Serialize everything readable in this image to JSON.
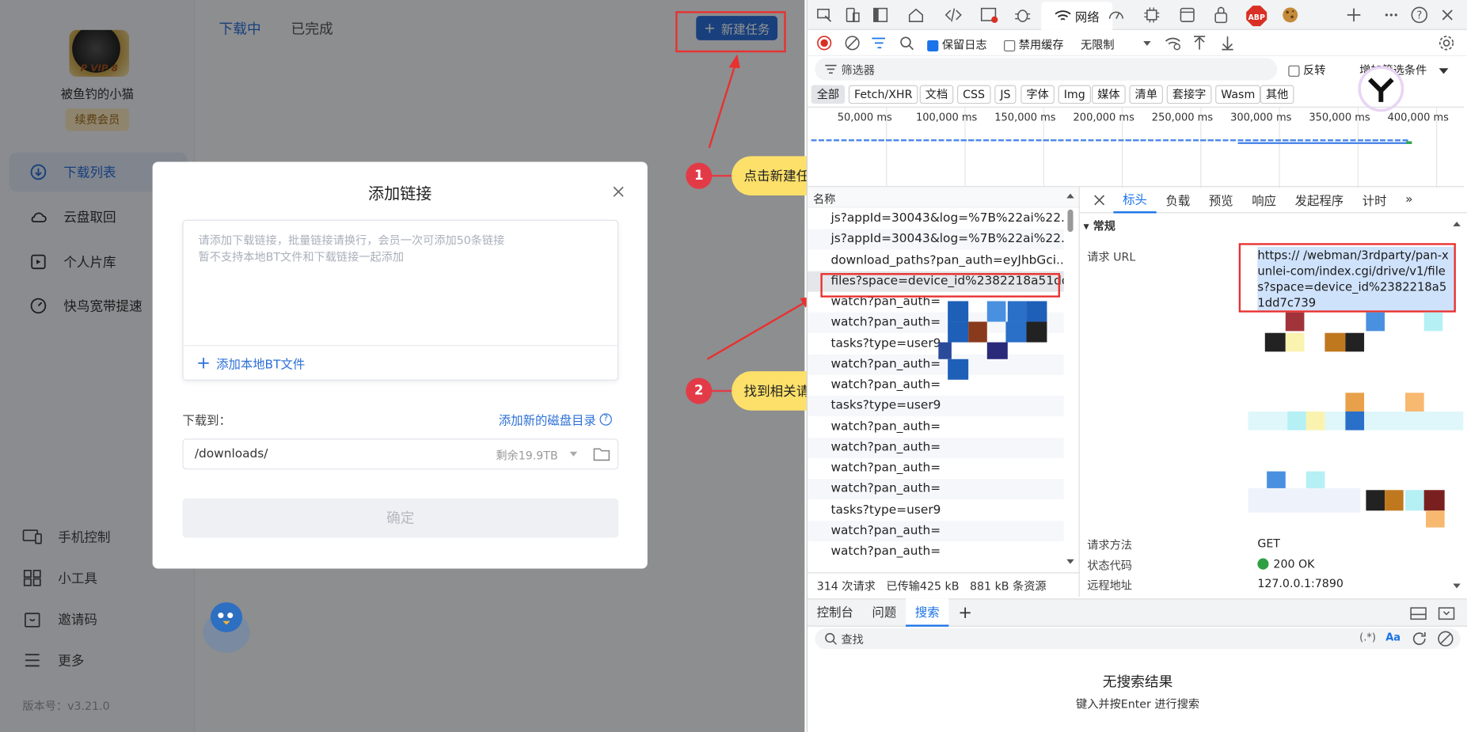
{
  "app": {
    "user": {
      "name": "被鱼钓的小猫",
      "avatar_text": "P VIP 8",
      "vip_label": "续费会员"
    },
    "nav": [
      {
        "label": "下载列表"
      },
      {
        "label": "云盘取回"
      },
      {
        "label": "个人片库"
      },
      {
        "label": "快鸟宽带提速"
      }
    ],
    "bottom_nav": [
      {
        "label": "手机控制"
      },
      {
        "label": "小工具"
      },
      {
        "label": "邀请码"
      },
      {
        "label": "更多"
      }
    ],
    "version": "版本号：v3.21.0",
    "tabs": {
      "downloading": "下载中",
      "completed": "已完成"
    },
    "new_task_label": "新建任务"
  },
  "dialog": {
    "title": "添加链接",
    "placeholder_line1": "请添加下载链接，批量链接请换行，会员一次可添加50条链接",
    "placeholder_line2": "暂不支持本地BT文件和下载链接一起添加",
    "add_bt_label": "添加本地BT文件",
    "save_to_label": "下载到：",
    "add_dir_label": "添加新的磁盘目录",
    "path": "/downloads/",
    "free_space": "剩余19.9TB",
    "confirm_label": "确定"
  },
  "annotations": {
    "step1": {
      "num": "1",
      "text": "点击新建任务"
    },
    "step2": {
      "num": "2",
      "text": "找到相关请求"
    },
    "accent": "#e8312f",
    "callout_color": "#fde069"
  },
  "devtools": {
    "network_tab": "网络",
    "preserve_log": "保留日志",
    "disable_cache": "禁用缓存",
    "throttle": "无限制",
    "filter_placeholder": "筛选器",
    "invert_label": "反转",
    "more_filters": "增加筛选条件",
    "type_filters": [
      "全部",
      "Fetch/XHR",
      "文档",
      "CSS",
      "JS",
      "字体",
      "Img",
      "媒体",
      "清单",
      "套接字",
      "Wasm",
      "其他"
    ],
    "timeline_labels": [
      "50,000 ms",
      "100,000 ms",
      "150,000 ms",
      "200,000 ms",
      "250,000 ms",
      "300,000 ms",
      "350,000 ms",
      "400,000 ms"
    ],
    "name_header": "名称",
    "requests": [
      "js?appId=30043&log=%7B%22ai%22...",
      "js?appId=30043&log=%7B%22ai%22...",
      "download_paths?pan_auth=eyJhbGci...",
      "files?space=device_id%2382218a51dd...",
      "watch?pan_auth=",
      "watch?pan_auth=",
      "tasks?type=user9",
      "watch?pan_auth=",
      "watch?pan_auth=",
      "tasks?type=user9",
      "watch?pan_auth=",
      "watch?pan_auth=",
      "watch?pan_auth=",
      "watch?pan_auth=",
      "tasks?type=user9",
      "watch?pan_auth=",
      "watch?pan_auth="
    ],
    "status_requests": "314 次请求",
    "status_transferred": "已传输425 kB",
    "status_resources": "881 kB 条资源",
    "detail_tabs": [
      "标头",
      "负载",
      "预览",
      "响应",
      "发起程序",
      "计时"
    ],
    "general_label": "常规",
    "request_url_label": "请求 URL",
    "request_url": "https://                              /webman/3rdparty/pan-xunlei-com/index.cgi/drive/v1/files?space=device_id%2382218a51dd7c739",
    "method_label": "请求方法",
    "method": "GET",
    "status_label": "状态代码",
    "status_code": "200 OK",
    "remote_label": "远程地址",
    "remote": "127.0.0.1:7890",
    "drawer_tabs": [
      "控制台",
      "问题",
      "搜索"
    ],
    "search_placeholder": "查找",
    "no_result": "无搜索结果",
    "no_result_hint": "键入并按Enter 进行搜索"
  }
}
